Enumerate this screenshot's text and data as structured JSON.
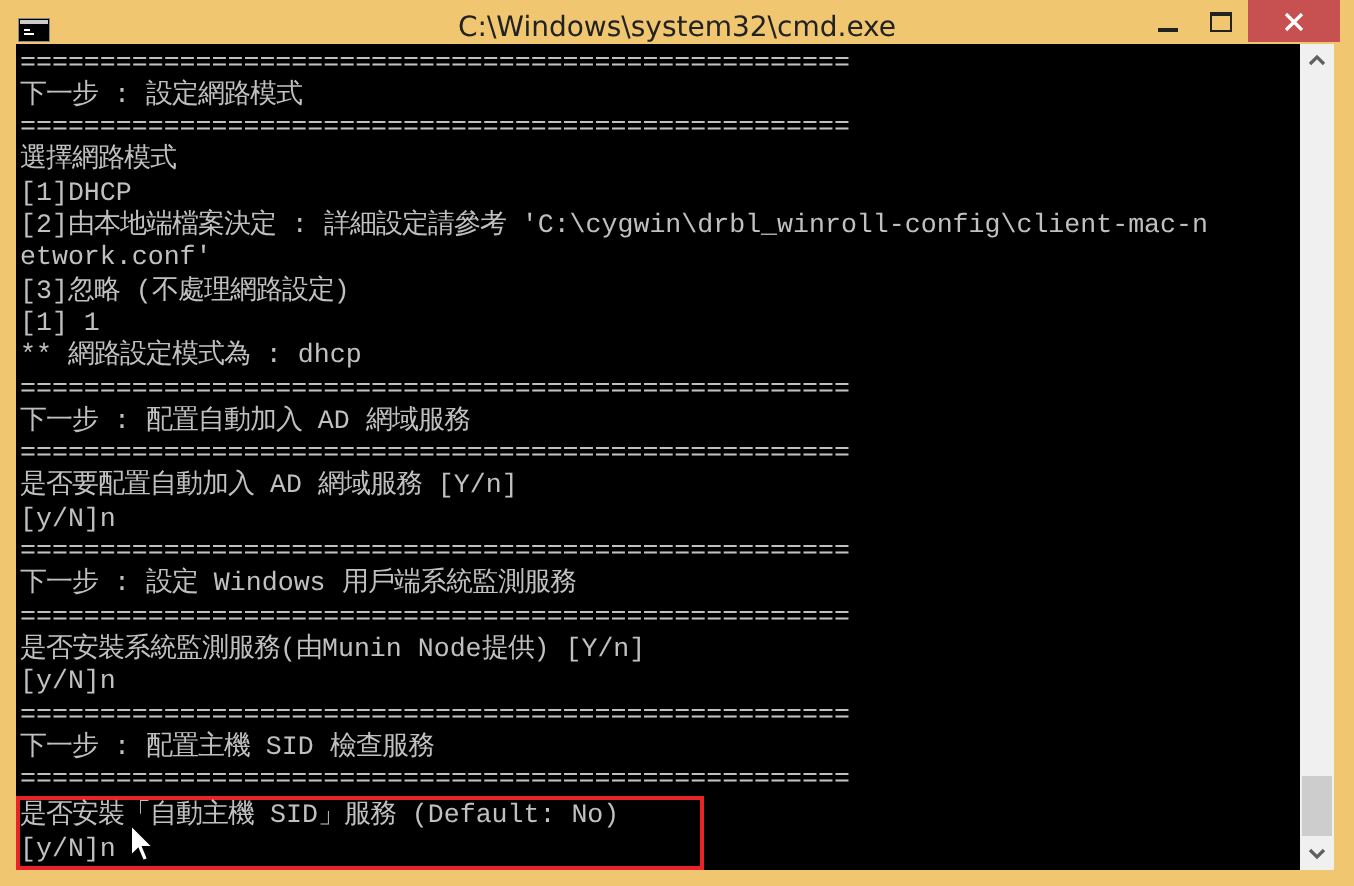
{
  "window": {
    "title": "C:\\Windows\\system32\\cmd.exe"
  },
  "console": {
    "lines": [
      "====================================================",
      "下一步 : 設定網路模式",
      "====================================================",
      "選擇網路模式",
      "[1]DHCP",
      "[2]由本地端檔案決定 : 詳細設定請參考 'C:\\cygwin\\drbl_winroll-config\\client-mac-n",
      "etwork.conf'",
      "[3]忽略 (不處理網路設定)",
      "[1] 1",
      "** 網路設定模式為 : dhcp",
      "====================================================",
      "下一步 : 配置自動加入 AD 網域服務",
      "====================================================",
      "是否要配置自動加入 AD 網域服務 [Y/n]",
      "[y/N]n",
      "====================================================",
      "下一步 : 設定 Windows 用戶端系統監測服務",
      "====================================================",
      "是否安裝系統監測服務(由Munin Node提供) [Y/n]",
      "[y/N]n",
      "====================================================",
      "下一步 : 配置主機 SID 檢查服務",
      "===================================================="
    ],
    "highlighted_lines": [
      "是否安裝「自動主機 SID」服務 (Default: No)",
      "[y/N]n"
    ]
  }
}
